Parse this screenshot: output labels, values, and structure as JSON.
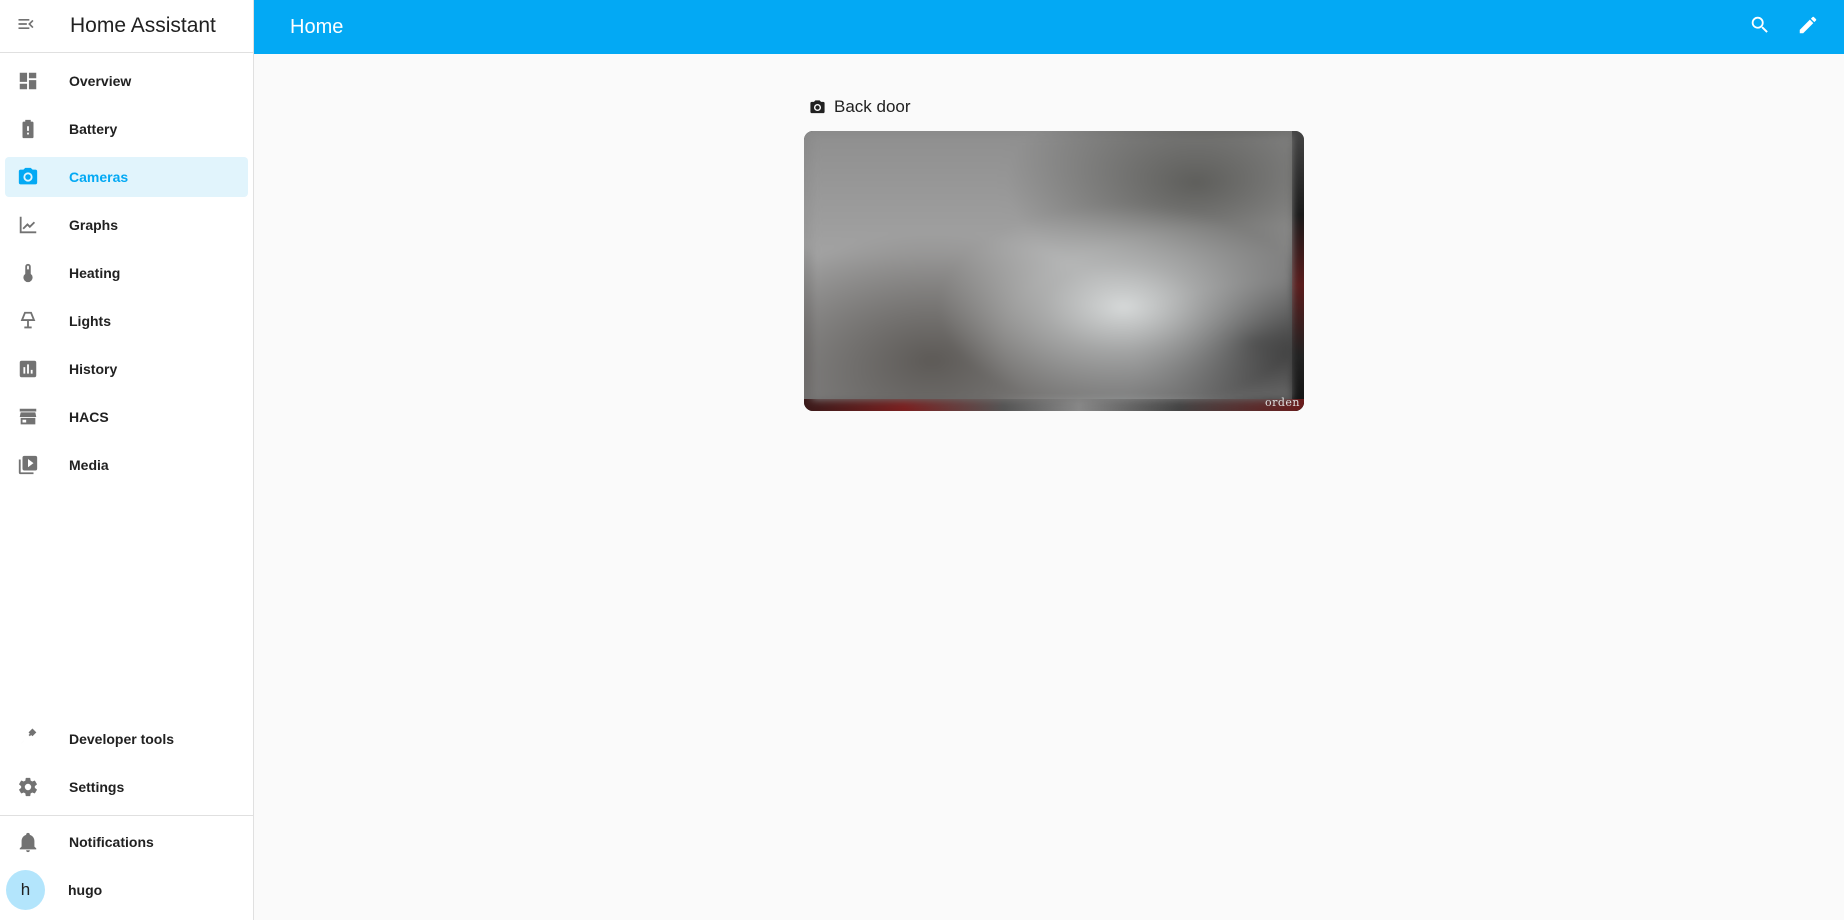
{
  "sidebar": {
    "title": "Home Assistant",
    "menu_icon": "menu-open-icon",
    "items": [
      {
        "label": "Overview",
        "icon": "dashboard-icon",
        "active": false
      },
      {
        "label": "Battery",
        "icon": "battery-alert-icon",
        "active": false
      },
      {
        "label": "Cameras",
        "icon": "camera-icon",
        "active": true
      },
      {
        "label": "Graphs",
        "icon": "chart-line-icon",
        "active": false
      },
      {
        "label": "Heating",
        "icon": "radiator-icon",
        "active": false
      },
      {
        "label": "Lights",
        "icon": "lamp-icon",
        "active": false
      },
      {
        "label": "History",
        "icon": "bar-chart-icon",
        "active": false
      },
      {
        "label": "HACS",
        "icon": "hacs-store-icon",
        "active": false
      },
      {
        "label": "Media",
        "icon": "media-play-icon",
        "active": false
      }
    ],
    "bottom_items": [
      {
        "label": "Developer tools",
        "icon": "hammer-icon"
      },
      {
        "label": "Settings",
        "icon": "gear-icon"
      }
    ],
    "notifications_label": "Notifications",
    "user": {
      "initial": "h",
      "name": "hugo"
    }
  },
  "header": {
    "title": "Home",
    "accent_color": "#03a9f4"
  },
  "card": {
    "title": "Back door",
    "icon": "camera-icon",
    "watermark": "orden"
  },
  "colors": {
    "accent": "#03a9f4",
    "active_bg": "#e1f4fc",
    "avatar_bg": "#b3e5fc",
    "icon_gray": "#727272"
  }
}
